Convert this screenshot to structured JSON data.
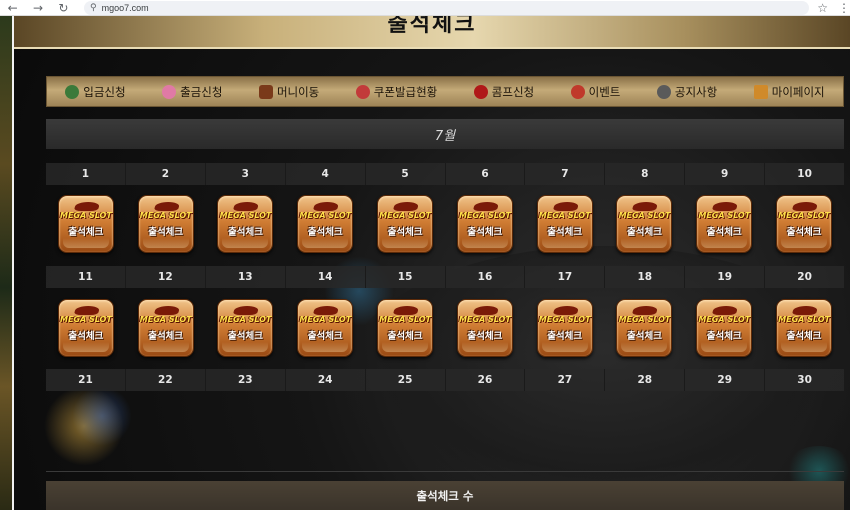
{
  "browser": {
    "back_icon": "arrow-left-icon",
    "forward_icon": "arrow-right-icon",
    "reload_icon": "reload-icon",
    "url": "mgoo7.com",
    "star_icon": "star-icon"
  },
  "header": {
    "title": "출석체크"
  },
  "menu": {
    "items": [
      {
        "label": "입금신청",
        "icon": "money-bag-icon",
        "color": "#3b7a3a"
      },
      {
        "label": "출금신청",
        "icon": "donut-icon",
        "color": "#e07aa5"
      },
      {
        "label": "머니이동",
        "icon": "chest-icon",
        "color": "#7a3a1a"
      },
      {
        "label": "쿠폰발급현황",
        "icon": "gift-icon",
        "color": "#c23a3a"
      },
      {
        "label": "콤프신청",
        "icon": "cherry-icon",
        "color": "#b01818"
      },
      {
        "label": "이벤트",
        "icon": "star-badge-icon",
        "color": "#c0392b"
      },
      {
        "label": "공지사항",
        "icon": "megaphone-icon",
        "color": "#5a5a5a"
      },
      {
        "label": "마이페이지",
        "icon": "castle-icon",
        "color": "#d08a2a"
      }
    ]
  },
  "calendar": {
    "month": "7월",
    "week1": [
      "1",
      "2",
      "3",
      "4",
      "5",
      "6",
      "7",
      "8",
      "9",
      "10"
    ],
    "week2": [
      "11",
      "12",
      "13",
      "14",
      "15",
      "16",
      "17",
      "18",
      "19",
      "20"
    ],
    "week3": [
      "21",
      "22",
      "23",
      "24",
      "25",
      "26",
      "27",
      "28",
      "29",
      "30"
    ],
    "badge_brand": "MEGA SLOT",
    "badge_label": "출석체크"
  },
  "footer": {
    "count_label": "출석체크 수"
  }
}
